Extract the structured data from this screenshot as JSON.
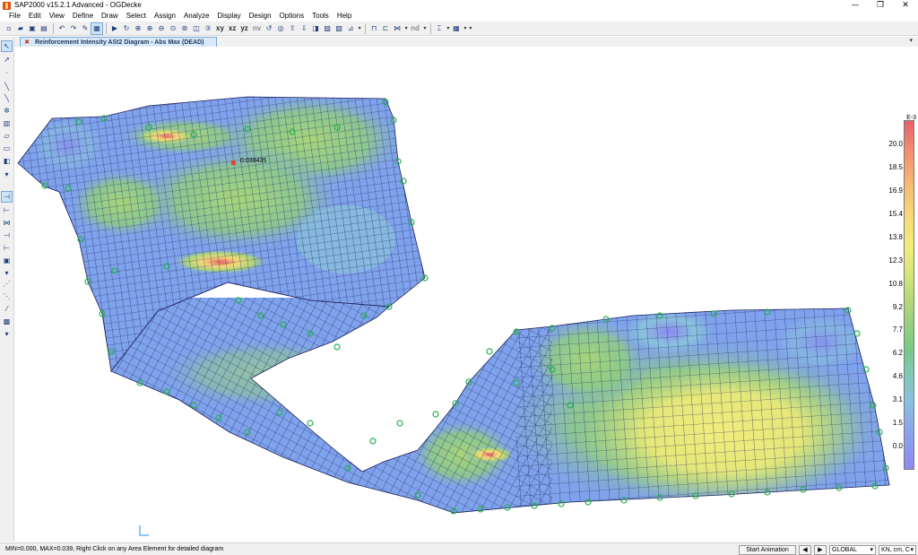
{
  "window": {
    "title": "SAP2000 v15.2.1 Advanced  - OGDecke",
    "minimize_glyph": "—",
    "maximize_glyph": "❐",
    "close_glyph": "✕"
  },
  "menu": [
    {
      "label": "File"
    },
    {
      "label": "Edit"
    },
    {
      "label": "View"
    },
    {
      "label": "Define"
    },
    {
      "label": "Draw"
    },
    {
      "label": "Select"
    },
    {
      "label": "Assign"
    },
    {
      "label": "Analyze"
    },
    {
      "label": "Display"
    },
    {
      "label": "Design"
    },
    {
      "label": "Options"
    },
    {
      "label": "Tools"
    },
    {
      "label": "Help"
    }
  ],
  "toolbar": {
    "view_xy": "xy",
    "view_xz": "xz",
    "view_yz": "yz",
    "view_nv": "nv",
    "view_nd": "nd"
  },
  "tab": {
    "label": "Reinforcement Intensity ASt2 Diagram - Abs Max  (DEAD)"
  },
  "model": {
    "annotation": "0.038435"
  },
  "legend": {
    "title": "E-3",
    "ticks": [
      "20.0",
      "18.5",
      "16.9",
      "15.4",
      "13.8",
      "12.3",
      "10.8",
      "9.2",
      "7.7",
      "6.2",
      "4.6",
      "3.1",
      "1.5",
      "0.0"
    ],
    "colors": {
      "max": "#e8606a",
      "mid": "#f2ec7c",
      "low": "#79c787",
      "min": "#8b89f0"
    }
  },
  "status": {
    "text": "MIN=0.000, MAX=0.039, Right Click on any Area Element for detailed diagram",
    "start_animation": "Start Animation",
    "coord_system": "GLOBAL",
    "units": "KN, cm, C"
  },
  "colors": {
    "mesh_base": "#7fa2ec",
    "mesh_line": "#1a1f5a",
    "support": "#22b14c"
  }
}
